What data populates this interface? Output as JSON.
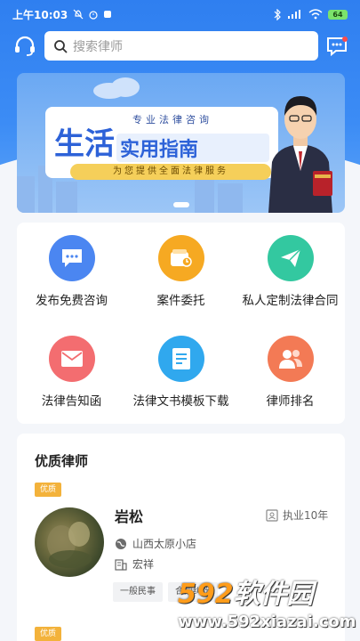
{
  "status_bar": {
    "time": "上午10:03",
    "battery": "64"
  },
  "search": {
    "placeholder": "搜索律师"
  },
  "banner": {
    "subtitle": "专业法律咨询",
    "title_part1": "生活",
    "title_part2": "实用指南",
    "tagline": "为您提供全面法律服务"
  },
  "menu": {
    "items": [
      {
        "label": "发布免费咨询",
        "icon": "chat-bubble-icon",
        "color": "#4b86f1"
      },
      {
        "label": "案件委托",
        "icon": "wallet-icon",
        "color": "#f6a922"
      },
      {
        "label": "私人定制法律合同",
        "icon": "paper-plane-icon",
        "color": "#33c8a0"
      },
      {
        "label": "法律告知函",
        "icon": "envelope-icon",
        "color": "#f36d70"
      },
      {
        "label": "法律文书模板下载",
        "icon": "document-icon",
        "color": "#30a8ee"
      },
      {
        "label": "律师排名",
        "icon": "people-icon",
        "color": "#f37a55"
      }
    ]
  },
  "lawyers": {
    "section_title": "优质律师",
    "badge": "优质",
    "items": [
      {
        "name": "岩松",
        "years": "执业10年",
        "location": "山西太原小店",
        "firm": "宏祥",
        "tags": [
          "一般民事",
          "合同纠纷"
        ]
      }
    ],
    "second_badge": "优质"
  },
  "watermark": {
    "line1_num": "592",
    "line1_text": "软件园",
    "line2": "www.592xiazai.com"
  }
}
